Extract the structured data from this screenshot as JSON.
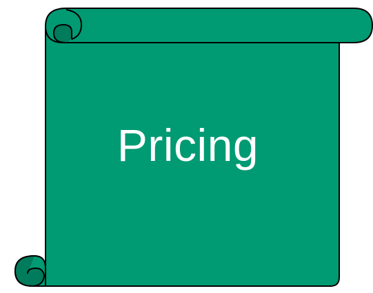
{
  "banner": {
    "title": "Pricing"
  },
  "colors": {
    "scroll_fill": "#009A73",
    "scroll_shadow": "#007B5C",
    "outline": "#000000",
    "title_text": "#FFFFFF"
  }
}
